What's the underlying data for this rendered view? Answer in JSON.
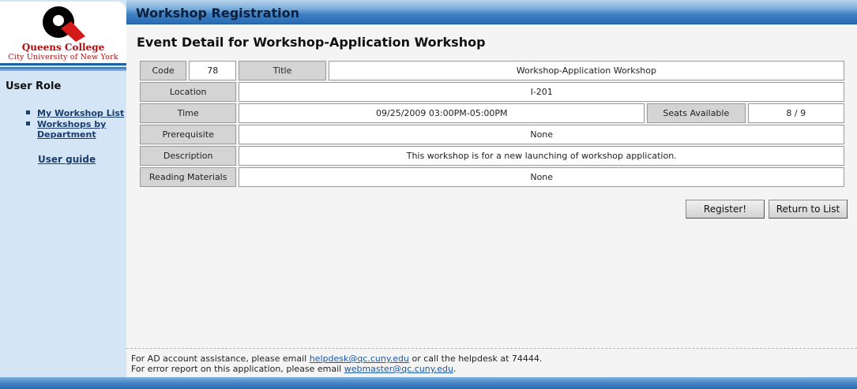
{
  "app": {
    "title": "Workshop Registration"
  },
  "logo": {
    "name": "Queens College",
    "subtitle": "City University of New York"
  },
  "sidebar": {
    "role_heading": "User Role",
    "items": [
      {
        "label": "My Workshop List"
      },
      {
        "label": "Workshops by Department"
      }
    ],
    "user_guide": "User guide"
  },
  "main": {
    "heading": "Event Detail for Workshop-Application Workshop",
    "fields": {
      "code_label": "Code",
      "code_value": "78",
      "title_label": "Title",
      "title_value": "Workshop-Application Workshop",
      "location_label": "Location",
      "location_value": "I-201",
      "time_label": "Time",
      "time_value": "09/25/2009 03:00PM-05:00PM",
      "seats_label": "Seats Available",
      "seats_value": "8 / 9",
      "prereq_label": "Prerequisite",
      "prereq_value": "None",
      "description_label": "Description",
      "description_value": "This workshop is for a new launching of workshop application.",
      "reading_label": "Reading Materials",
      "reading_value": "None"
    },
    "buttons": {
      "register": "Register!",
      "return": "Return to List"
    }
  },
  "footer": {
    "line1_prefix": "For AD account assistance, please email ",
    "line1_link": "helpdesk@qc.cuny.edu",
    "line1_suffix": " or call the helpdesk at 74444.",
    "line2_prefix": "For error report on this application, please email ",
    "line2_link": "webmaster@qc.cuny.edu",
    "line2_suffix": "."
  },
  "colors": {
    "brand_red": "#b10d0d",
    "header_blue": "#2a6bb1",
    "sidebar_bg": "#d4e6f6",
    "link": "#1a3d6e"
  }
}
